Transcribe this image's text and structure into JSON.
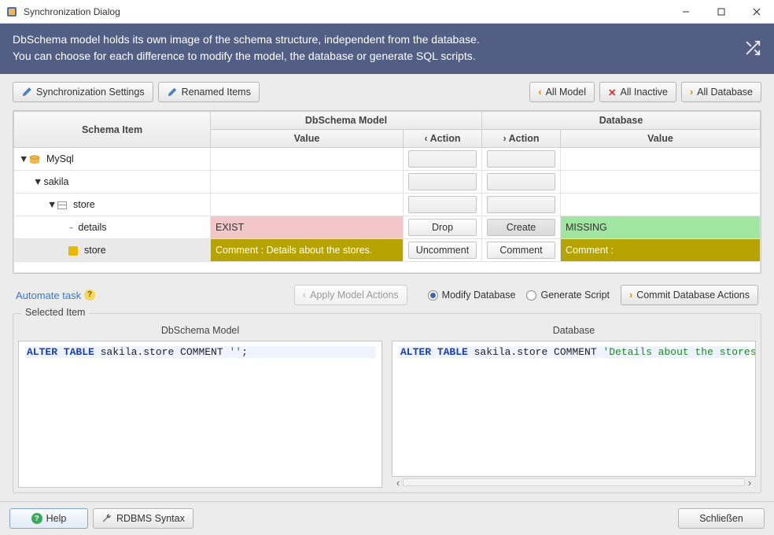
{
  "window": {
    "title": "Synchronization Dialog"
  },
  "banner": {
    "line1": "DbSchema model holds its own image of the schema structure, independent from the database.",
    "line2": "You can choose for each difference to modify the model, the database or generate SQL scripts."
  },
  "toolbar": {
    "sync_settings": "Synchronization Settings",
    "renamed_items": "Renamed Items",
    "all_model": "All Model",
    "all_inactive": "All Inactive",
    "all_database": "All Database"
  },
  "table": {
    "headers": {
      "schema_item": "Schema Item",
      "model_group": "DbSchema Model",
      "db_group": "Database",
      "value": "Value",
      "action_left": "Action",
      "action_right": "Action"
    },
    "rows": {
      "mysql": "MySql",
      "sakila": "sakila",
      "store": "store",
      "details": "details",
      "store_leaf": "store"
    },
    "details_row": {
      "model_value": "EXIST",
      "model_action": "Drop",
      "db_action": "Create",
      "db_value": "MISSING"
    },
    "store_row": {
      "model_value": "Comment : Details about the stores.",
      "model_action": "Uncomment",
      "db_action": "Comment",
      "db_value": "Comment :"
    }
  },
  "midbar": {
    "automate": "Automate task",
    "apply_model": "Apply Model Actions",
    "modify_db": "Modify Database",
    "generate_script": "Generate Script",
    "commit_db": "Commit Database Actions"
  },
  "selected": {
    "legend": "Selected Item",
    "left_title": "DbSchema Model",
    "right_title": "Database",
    "left_sql": {
      "pre": "ALTER TABLE",
      "mid": " sakila.store COMMENT ",
      "str": "''",
      "post": ";"
    },
    "right_sql": {
      "pre": "ALTER TABLE",
      "mid": " sakila.store COMMENT ",
      "str": "'Details about the stores.'",
      "post": ";"
    }
  },
  "bottom": {
    "help": "Help",
    "rdbms": "RDBMS Syntax",
    "close": "Schließen"
  }
}
